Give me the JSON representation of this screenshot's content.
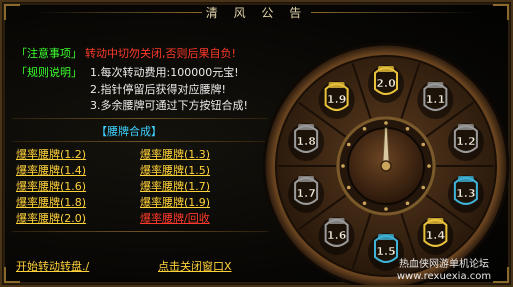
{
  "title": "清 风 公 告",
  "notice": {
    "label": "「注意事项」",
    "text": "转动中切勿关闭,否则后果自负!"
  },
  "rules": {
    "label": "「规则说明」",
    "items": [
      "1.每次转动费用:100000元宝!",
      "2.指针停留后获得对应腰牌!",
      "3.多余腰牌可通过下方按钮合成!"
    ]
  },
  "synthesis": {
    "header": "【腰牌合成】",
    "links": [
      {
        "label": "爆率腰牌(1.2)",
        "color": "yellow"
      },
      {
        "label": "爆率腰牌(1.3)",
        "color": "yellow"
      },
      {
        "label": "爆率腰牌(1.4)",
        "color": "yellow"
      },
      {
        "label": "爆率腰牌(1.5)",
        "color": "yellow"
      },
      {
        "label": "爆率腰牌(1.6)",
        "color": "yellow"
      },
      {
        "label": "爆率腰牌(1.7)",
        "color": "yellow"
      },
      {
        "label": "爆率腰牌(1.8)",
        "color": "yellow"
      },
      {
        "label": "爆率腰牌(1.9)",
        "color": "yellow"
      },
      {
        "label": "爆率腰牌(2.0)",
        "color": "yellow"
      },
      {
        "label": "爆率腰牌/回收",
        "color": "red"
      }
    ]
  },
  "actions": {
    "start": "开始转动转盘./",
    "close": "点击关闭窗口X"
  },
  "wheel": {
    "pointer_at": "12 o'clock",
    "tokens": [
      {
        "value": "2.0",
        "color": "#e8c23a"
      },
      {
        "value": "1.1",
        "color": "#9a9a9a"
      },
      {
        "value": "1.2",
        "color": "#9a9a9a"
      },
      {
        "value": "1.3",
        "color": "#3fb3d8"
      },
      {
        "value": "1.4",
        "color": "#e8c23a"
      },
      {
        "value": "1.5",
        "color": "#3fb3d8"
      },
      {
        "value": "1.6",
        "color": "#9a9a9a"
      },
      {
        "value": "1.7",
        "color": "#9a9a9a"
      },
      {
        "value": "1.8",
        "color": "#9a9a9a"
      },
      {
        "value": "1.9",
        "color": "#e8c23a"
      }
    ]
  },
  "watermark": {
    "line1": "热血侠网游单机论坛",
    "line2": "www.rexuexia.com"
  }
}
